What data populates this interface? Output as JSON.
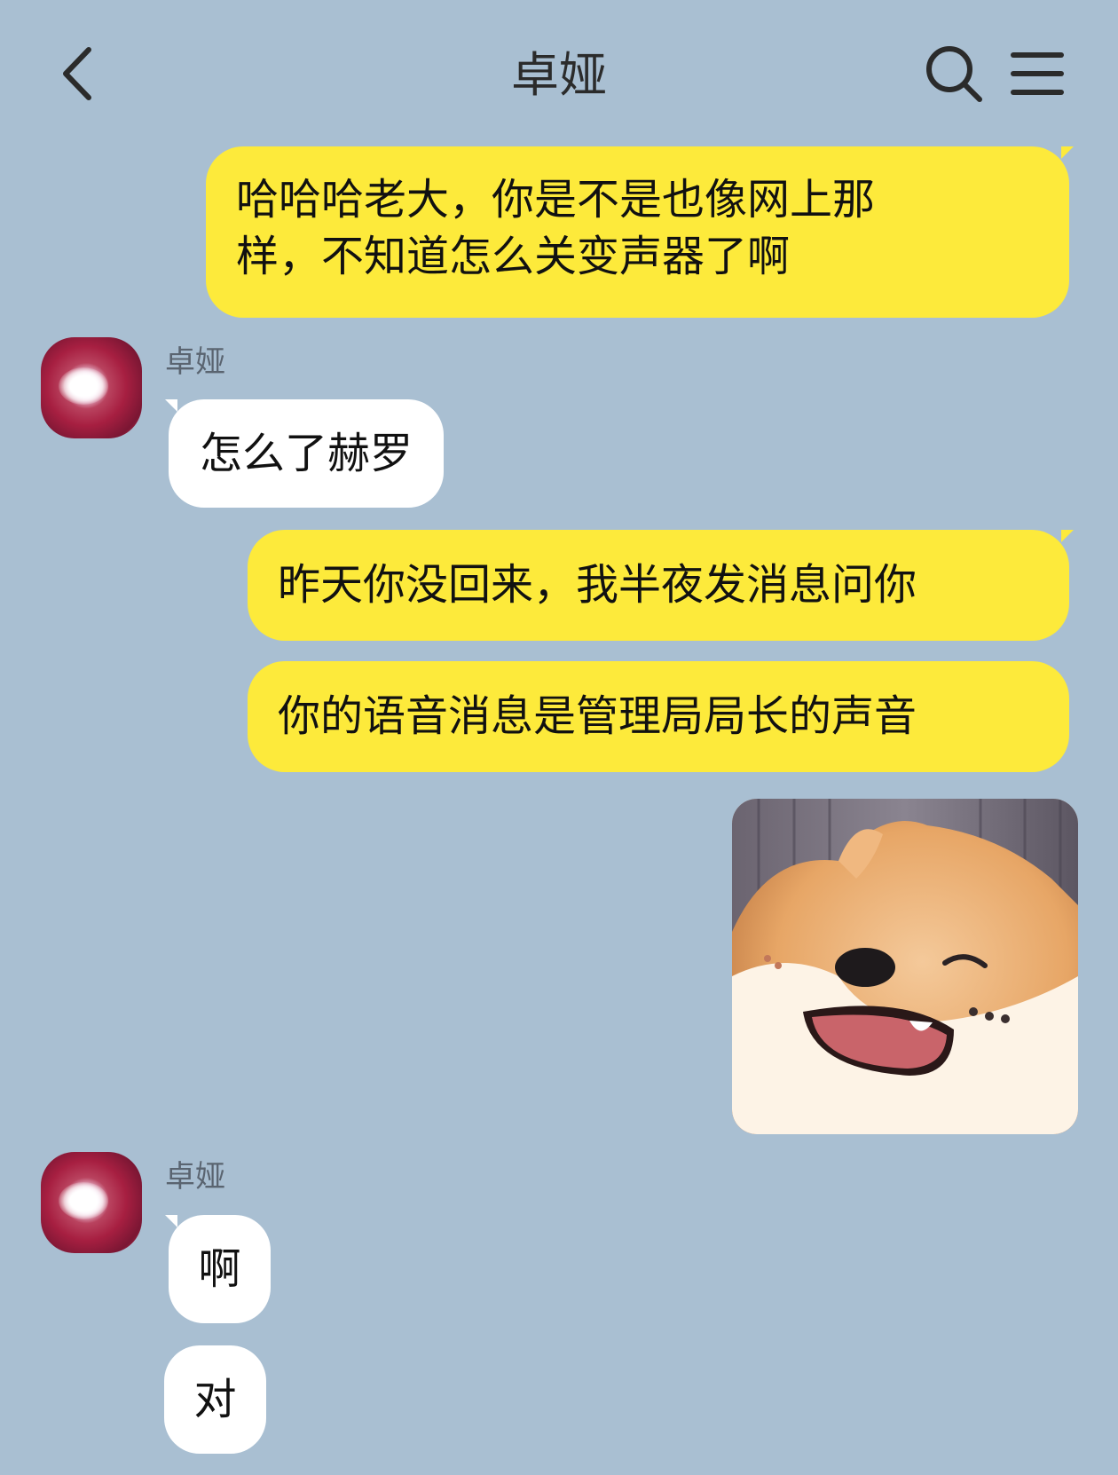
{
  "header": {
    "title": "卓娅"
  },
  "messages": {
    "m1_line1": "哈哈哈老大，你是不是也像网上那",
    "m1_line2": "样，不知道怎么关变声器了啊",
    "sender1": "卓娅",
    "m2": "怎么了赫罗",
    "m3": "昨天你没回来，我半夜发消息问你",
    "m4": "你的语音消息是管理局局长的声音",
    "sticker": "shiba-laughing-sticker",
    "sender2": "卓娅",
    "m5": "啊",
    "m6": "对"
  },
  "colors": {
    "background": "#a9bfd2",
    "my_bubble": "#fdea3b",
    "other_bubble": "#ffffff"
  },
  "icons": {
    "back": "chevron-left-icon",
    "search": "search-icon",
    "menu": "menu-icon"
  }
}
